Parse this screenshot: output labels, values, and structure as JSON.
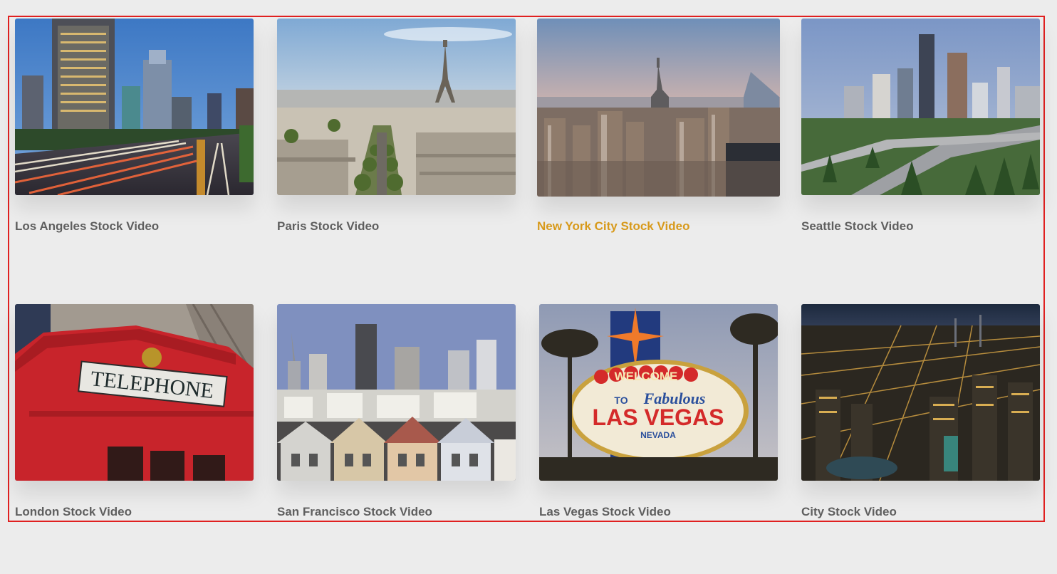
{
  "gallery": {
    "items": [
      {
        "title": "Los Angeles Stock Video",
        "image": "los-angeles-freeway-skyline",
        "active": false
      },
      {
        "title": "Paris Stock Video",
        "image": "paris-eiffel-tower-rooftops",
        "active": false
      },
      {
        "title": "New York City Stock Video",
        "image": "new-york-empire-state-skyline",
        "active": true
      },
      {
        "title": "Seattle Stock Video",
        "image": "seattle-skyline-highway",
        "active": false
      },
      {
        "title": "London Stock Video",
        "image": "london-red-telephone-box",
        "active": false
      },
      {
        "title": "San Francisco Stock Video",
        "image": "san-francisco-painted-ladies",
        "active": false
      },
      {
        "title": "Las Vegas Stock Video",
        "image": "las-vegas-welcome-sign",
        "active": false
      },
      {
        "title": "City Stock Video",
        "image": "city-night-aerial",
        "active": false
      }
    ],
    "colors": {
      "caption": "#5f5f5f",
      "caption_active": "#d89a1b",
      "selection_border": "#e02020"
    }
  },
  "images": {
    "telephone_sign": "TELEPHONE",
    "vegas_welcome": "WELCOME",
    "vegas_to": "TO",
    "vegas_fabulous": "Fabulous",
    "vegas_main": "LAS VEGAS",
    "vegas_nevada": "NEVADA"
  }
}
